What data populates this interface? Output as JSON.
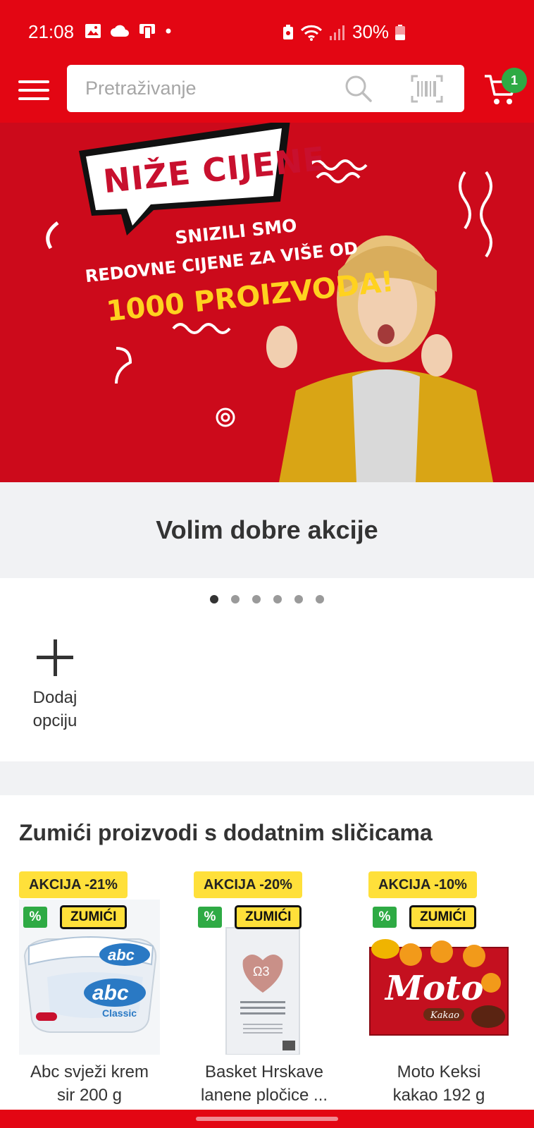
{
  "status_bar": {
    "time": "21:08",
    "battery": "30%"
  },
  "header": {
    "search_placeholder": "Pretraživanje",
    "cart_count": "1"
  },
  "banner": {
    "headline": "NIŽE CIJENE",
    "line1": "SNIZILI SMO",
    "line2": "REDOVNE CIJENE ZA VIŠE OD",
    "line3": "1000 PROIZVODA!",
    "caption": "Volim dobre akcije",
    "slides": 6,
    "active_slide": 1
  },
  "add_option": {
    "label_line1": "Dodaj",
    "label_line2": "opciju"
  },
  "section": {
    "title": "Zumići proizvodi s dodatnim sličicama"
  },
  "products": [
    {
      "badge": "AKCIJA -21%",
      "pct": "%",
      "tag": "ZUMIĆI",
      "name_line1": "Abc svježi krem",
      "name_line2": "sir 200 g"
    },
    {
      "badge": "AKCIJA -20%",
      "pct": "%",
      "tag": "ZUMIĆI",
      "name_line1": "Basket Hrskave",
      "name_line2": "lanene pločice ..."
    },
    {
      "badge": "AKCIJA -10%",
      "pct": "%",
      "tag": "ZUMIĆI",
      "name_line1": "Moto Keksi",
      "name_line2": "kakao 192 g"
    }
  ],
  "colors": {
    "brand_red": "#e30613",
    "badge_yellow": "#ffe03a",
    "badge_green": "#2eaa44"
  }
}
